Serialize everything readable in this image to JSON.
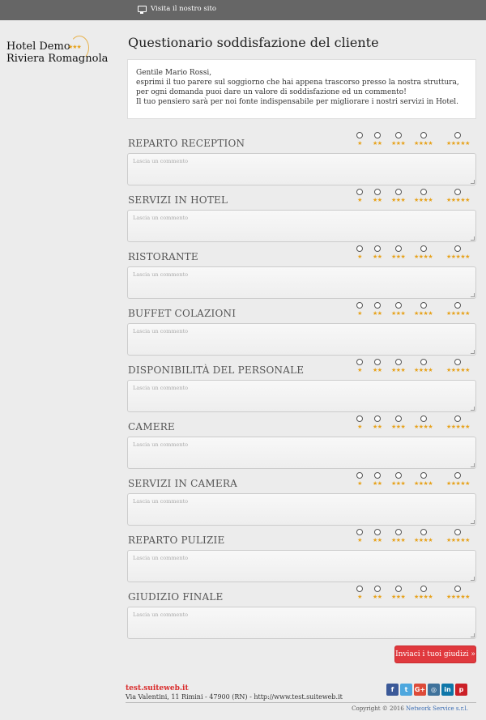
{
  "topbar": {
    "visit_site": "Visita il nostro sito",
    "icon": "monitor-icon"
  },
  "logo": {
    "line1": "Hotel Demo",
    "line2": "Riviera Romagnola",
    "stars": "★★★"
  },
  "page_title": "Questionario soddisfazione del cliente",
  "intro": {
    "greeting": "Gentile Mario Rossi,",
    "p1": "esprimi il tuo parere sul soggiorno che hai appena trascorso presso la nostra struttura, per ogni domanda puoi dare un valore di soddisfazione ed un commento!",
    "p2": "Il tuo pensiero sarà per noi fonte indispensabile per migliorare i nostri servizi in Hotel."
  },
  "rating_labels": [
    "★",
    "★★",
    "★★★",
    "★★★★",
    "★★★★★"
  ],
  "comment_placeholder": "Lascia un commento",
  "questions": [
    {
      "label": "REPARTO RECEPTION"
    },
    {
      "label": "SERVIZI IN HOTEL"
    },
    {
      "label": "RISTORANTE"
    },
    {
      "label": "BUFFET COLAZIONI"
    },
    {
      "label": "DISPONIBILITÀ DEL PERSONALE"
    },
    {
      "label": "CAMERE"
    },
    {
      "label": "SERVIZI IN CAMERA"
    },
    {
      "label": "REPARTO PULIZIE"
    },
    {
      "label": "GIUDIZIO FINALE"
    }
  ],
  "submit_label": "Inviaci i tuoi giudizi »",
  "footer": {
    "brand": "test.suiteweb.it",
    "address": "Via Valentini, 11 Rimini - 47900 (RN) - http://www.test.suiteweb.it",
    "copyright": "Copyright © 2016",
    "company": "Network Service s.r.l."
  },
  "social": [
    {
      "name": "facebook-icon",
      "glyph": "f",
      "color": "#3b5998"
    },
    {
      "name": "twitter-icon",
      "glyph": "t",
      "color": "#4da7de"
    },
    {
      "name": "google-plus-icon",
      "glyph": "G+",
      "color": "#dd4b39"
    },
    {
      "name": "instagram-icon",
      "glyph": "◎",
      "color": "#3f729b"
    },
    {
      "name": "linkedin-icon",
      "glyph": "in",
      "color": "#0e76a8"
    },
    {
      "name": "pinterest-icon",
      "glyph": "p",
      "color": "#cb2027"
    }
  ]
}
